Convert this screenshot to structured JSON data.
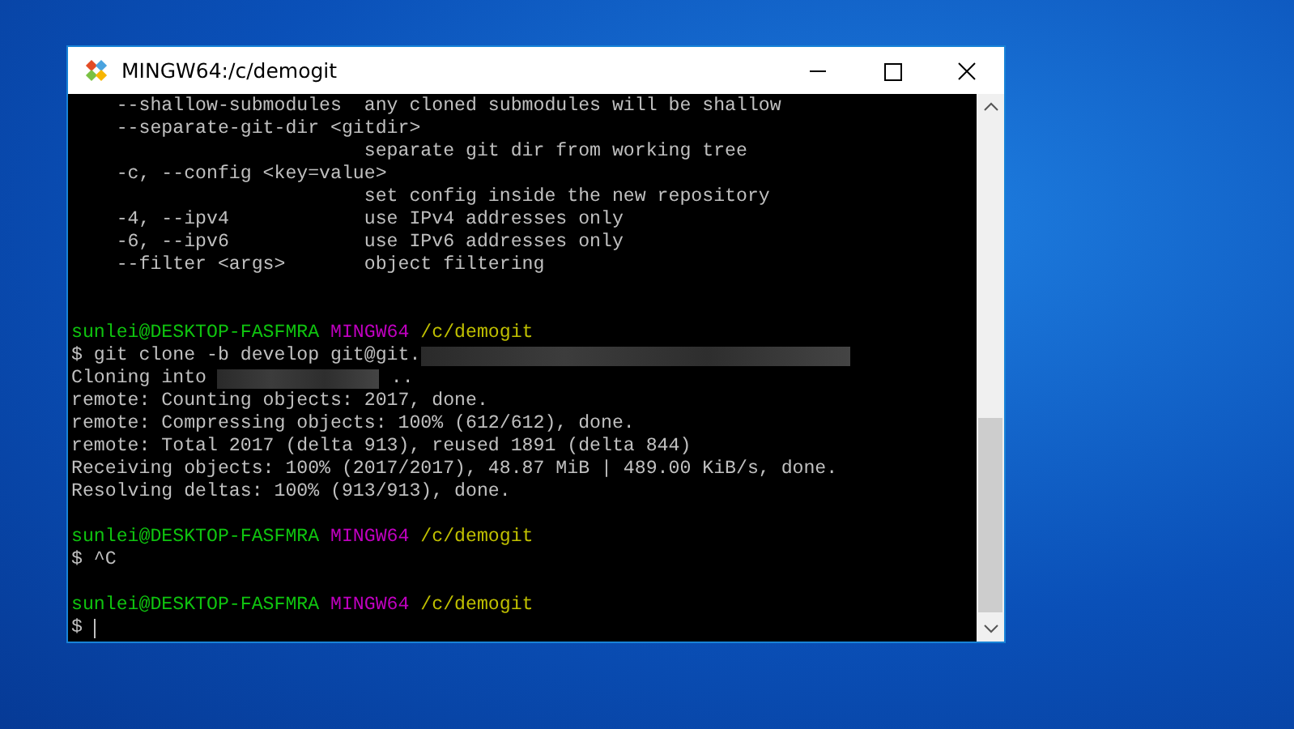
{
  "window": {
    "title": "MINGW64:/c/demogit"
  },
  "terminal": {
    "lines": [
      {
        "kind": "text",
        "text": "    --shallow-submodules  any cloned submodules will be shallow"
      },
      {
        "kind": "text",
        "text": "    --separate-git-dir <gitdir>"
      },
      {
        "kind": "text",
        "text": "                          separate git dir from working tree"
      },
      {
        "kind": "text",
        "text": "    -c, --config <key=value>"
      },
      {
        "kind": "text",
        "text": "                          set config inside the new repository"
      },
      {
        "kind": "text",
        "text": "    -4, --ipv4            use IPv4 addresses only"
      },
      {
        "kind": "text",
        "text": "    -6, --ipv6            use IPv6 addresses only"
      },
      {
        "kind": "text",
        "text": "    --filter <args>       object filtering"
      },
      {
        "kind": "blank"
      },
      {
        "kind": "blank"
      },
      {
        "kind": "prompt",
        "user": "sunlei@DESKTOP-FASFMRA",
        "host": "MINGW64",
        "path": "/c/demogit"
      },
      {
        "kind": "redacted",
        "before": "$ git clone -b develop git@git."
      },
      {
        "kind": "redacted",
        "before": "Cloning into ",
        "after": " .."
      },
      {
        "kind": "text",
        "text": "remote: Counting objects: 2017, done."
      },
      {
        "kind": "text",
        "text": "remote: Compressing objects: 100% (612/612), done."
      },
      {
        "kind": "text",
        "text": "remote: Total 2017 (delta 913), reused 1891 (delta 844)"
      },
      {
        "kind": "text",
        "text": "Receiving objects: 100% (2017/2017), 48.87 MiB | 489.00 KiB/s, done."
      },
      {
        "kind": "text",
        "text": "Resolving deltas: 100% (913/913), done."
      },
      {
        "kind": "blank"
      },
      {
        "kind": "prompt",
        "user": "sunlei@DESKTOP-FASFMRA",
        "host": "MINGW64",
        "path": "/c/demogit"
      },
      {
        "kind": "text",
        "text": "$ ^C"
      },
      {
        "kind": "blank"
      },
      {
        "kind": "prompt",
        "user": "sunlei@DESKTOP-FASFMRA",
        "host": "MINGW64",
        "path": "/c/demogit"
      },
      {
        "kind": "input",
        "text": "$"
      }
    ]
  }
}
